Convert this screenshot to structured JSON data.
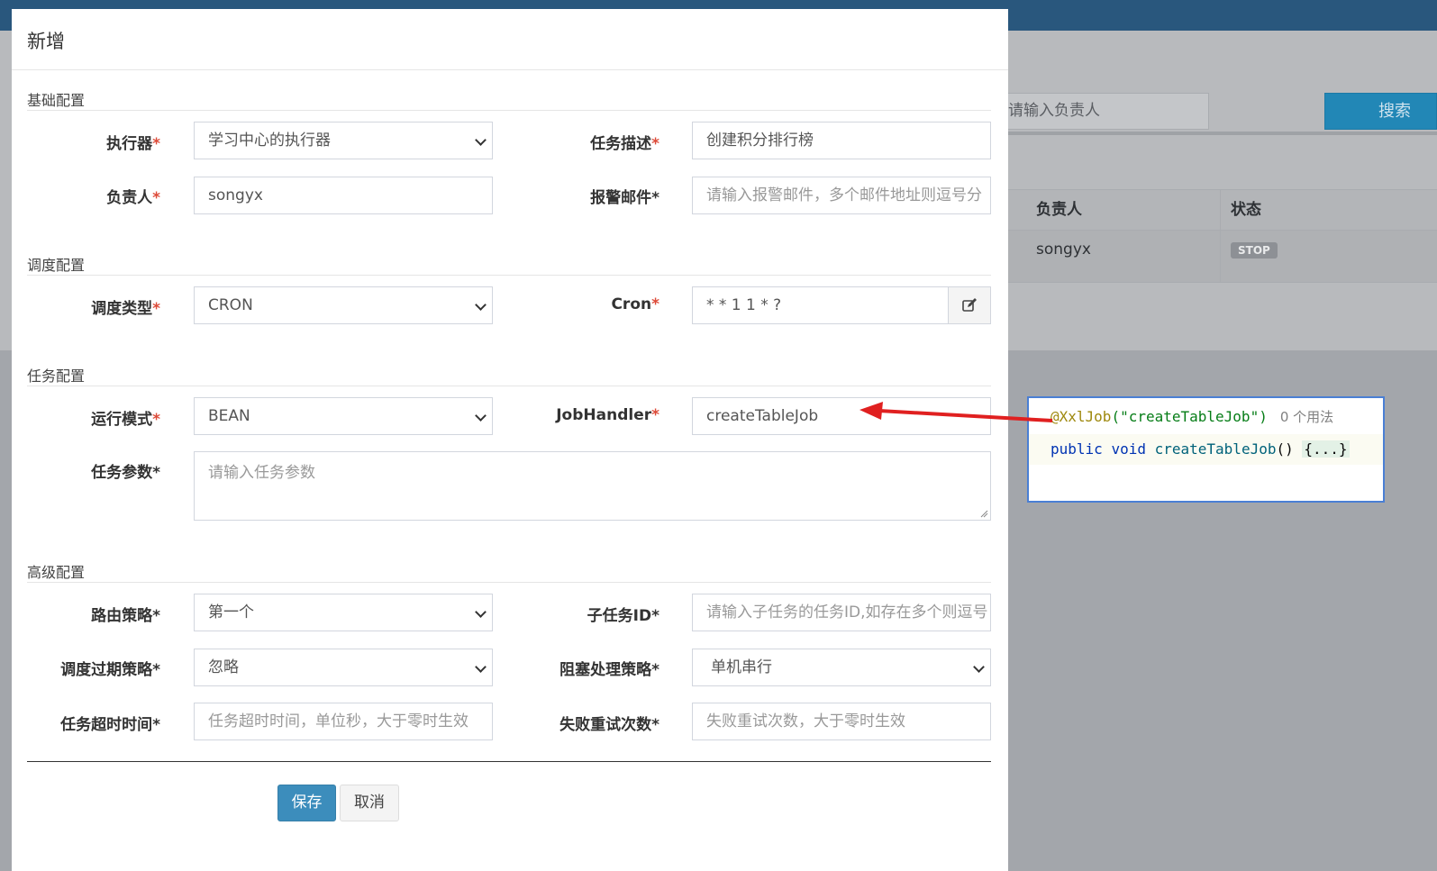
{
  "background": {
    "search_placeholder": "请输入负责人",
    "search_button": "搜索",
    "table": {
      "headers": [
        "负责人",
        "状态"
      ],
      "rows": [
        {
          "owner": "songyx",
          "status": "STOP"
        }
      ]
    }
  },
  "modal": {
    "title": "新增",
    "sections": {
      "basic": "基础配置",
      "schedule": "调度配置",
      "task": "任务配置",
      "advanced": "高级配置"
    },
    "fields": {
      "executor": {
        "label": "执行器",
        "value": "学习中心的执行器"
      },
      "desc": {
        "label": "任务描述",
        "value": "创建积分排行榜"
      },
      "owner": {
        "label": "负责人",
        "value": "songyx"
      },
      "alarm_email": {
        "label": "报警邮件*",
        "placeholder": "请输入报警邮件，多个邮件地址则逗号分"
      },
      "schedule_type": {
        "label": "调度类型",
        "value": "CRON"
      },
      "cron": {
        "label": "Cron",
        "value": "* * 1 1 * ?"
      },
      "run_mode": {
        "label": "运行模式",
        "value": "BEAN"
      },
      "job_handler": {
        "label": "JobHandler",
        "value": "createTableJob"
      },
      "task_param": {
        "label": "任务参数*",
        "placeholder": "请输入任务参数"
      },
      "route": {
        "label": "路由策略*",
        "value": "第一个"
      },
      "child_id": {
        "label": "子任务ID*",
        "placeholder": "请输入子任务的任务ID,如存在多个则逗号"
      },
      "misfire": {
        "label": "调度过期策略*",
        "value": "忽略"
      },
      "block": {
        "label": "阻塞处理策略*",
        "value": "单机串行"
      },
      "timeout": {
        "label": "任务超时时间*",
        "placeholder": "任务超时时间，单位秒，大于零时生效"
      },
      "retry": {
        "label": "失败重试次数*",
        "placeholder": "失败重试次数，大于零时生效"
      }
    },
    "buttons": {
      "save": "保存",
      "cancel": "取消"
    }
  },
  "code": {
    "annotation": "@XxlJob",
    "annotation_arg": "(\"createTableJob\")",
    "usages": "0 个用法",
    "keyword_public": "public",
    "keyword_void": "void",
    "method": "createTableJob",
    "parens": "()",
    "folded_body": "{...}"
  },
  "colors": {
    "primary": "#3c8dbc",
    "required": "#dd4b39",
    "arrow": "#e02020",
    "topbar": "#29577d"
  }
}
